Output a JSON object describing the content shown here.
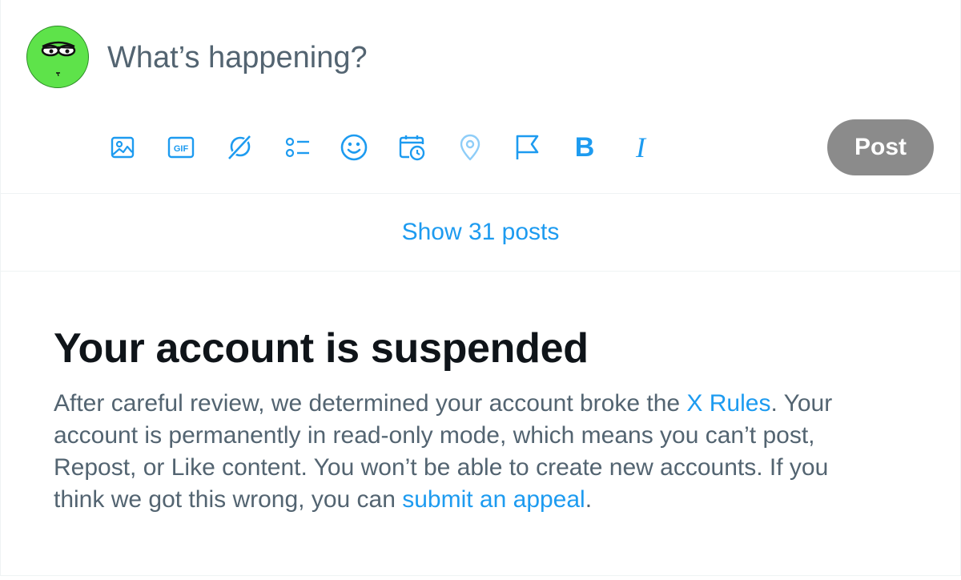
{
  "composer": {
    "placeholder": "What’s happening?",
    "post_label": "Post",
    "tools": [
      {
        "icon": "image-icon"
      },
      {
        "icon": "gif-icon",
        "label": "GIF"
      },
      {
        "icon": "grok-icon"
      },
      {
        "icon": "poll-icon"
      },
      {
        "icon": "emoji-icon"
      },
      {
        "icon": "schedule-icon"
      },
      {
        "icon": "location-icon"
      },
      {
        "icon": "flag-icon"
      },
      {
        "icon": "bold-icon",
        "label": "B"
      },
      {
        "icon": "italic-icon",
        "label": "I"
      }
    ]
  },
  "feed": {
    "show_posts_label": "Show 31 posts"
  },
  "notice": {
    "title": "Your account is suspended",
    "body_part1": "After careful review, we determined your account broke the ",
    "rules_link": "X Rules",
    "body_part2": ". Your account is permanently in read-only mode, which means you can’t post, Repost, or Like content. You won’t be able to create new accounts. If you think we got this wrong, you can ",
    "appeal_link": "submit an appeal",
    "body_part3": "."
  },
  "colors": {
    "accent": "#1d9bf0",
    "secondary_text": "#536471",
    "primary_text": "#0f1419",
    "post_button_disabled": "#8b8b8b",
    "avatar_green": "#5ee34a"
  }
}
